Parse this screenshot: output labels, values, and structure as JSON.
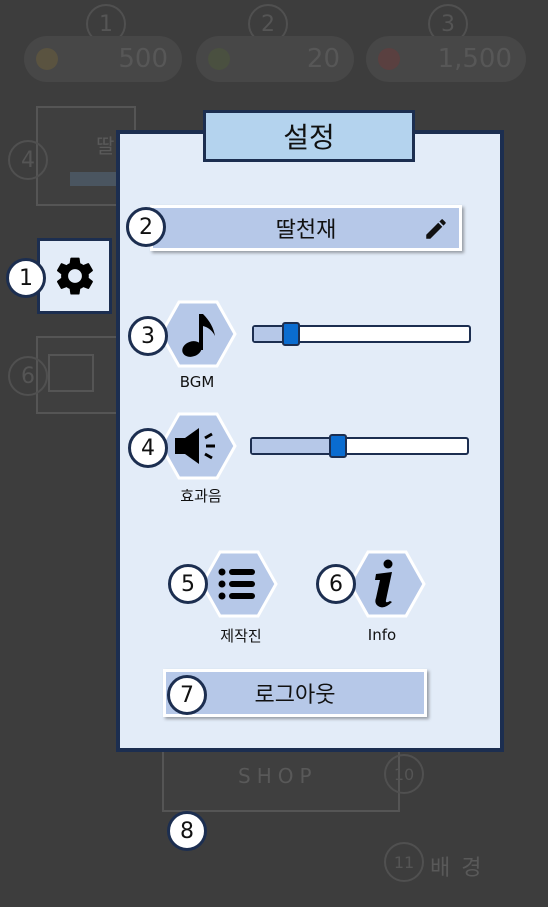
{
  "background": {
    "top_numbers": [
      "1",
      "2",
      "3"
    ],
    "currencies": [
      {
        "value": "500"
      },
      {
        "value": "20"
      },
      {
        "value": "1,500"
      }
    ],
    "side_numbers": [
      "4",
      "6"
    ],
    "partial_name": "딸",
    "shop_label": "SHOP",
    "shop_number": "10",
    "bottom_number": "11",
    "bottom_label": "배 경"
  },
  "annotations": [
    "1",
    "2",
    "3",
    "4",
    "5",
    "6",
    "7",
    "8"
  ],
  "settings": {
    "title": "설정",
    "nickname": "딸천재",
    "bgm_label": "BGM",
    "bgm_level": 0.17,
    "sfx_label": "효과음",
    "sfx_level": 0.4,
    "credits_label": "제작진",
    "info_label": "Info",
    "logout_label": "로그아웃"
  },
  "colors": {
    "panel_bg": "#e3ecf8",
    "border": "#1c2e50",
    "button_bg": "#b6c8e8",
    "title_bg": "#b4d3ee",
    "thumb": "#0a6cd0",
    "backdrop": "#3d3d3d"
  },
  "icons": [
    "gear-icon",
    "pencil-icon",
    "music-note-icon",
    "speaker-icon",
    "list-icon",
    "info-icon"
  ]
}
